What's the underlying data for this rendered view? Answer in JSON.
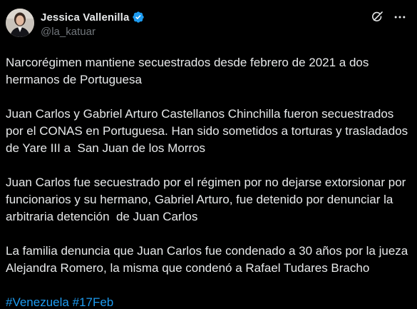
{
  "author": {
    "display_name": "Jessica Vallenilla",
    "handle": "@la_katuar",
    "verified_icon": "verified-badge-icon",
    "verified_color": "#1d9bf0"
  },
  "actions": {
    "grok_icon": "grok-icon",
    "more_icon": "more-options-icon"
  },
  "tweet": {
    "paragraphs": [
      "Narcorégimen mantiene secuestrados desde febrero de 2021 a dos hermanos de Portuguesa",
      "Juan Carlos y Gabriel Arturo Castellanos Chinchilla fueron secuestrados por el CONAS en Portuguesa. Han sido sometidos a torturas y trasladados de Yare III a  San Juan de los Morros",
      "Juan Carlos fue secuestrado por el régimen por no dejarse extorsionar por funcionarios y su hermano, Gabriel Arturo, fue detenido por denunciar la arbitraria detención  de Juan Carlos",
      "La familia denuncia que Juan Carlos fue condenado a 30 años por la jueza Alejandra Romero, la misma que condenó a Rafael Tudares Bracho"
    ],
    "hashtags": [
      "#Venezuela",
      "#17Feb"
    ]
  },
  "colors": {
    "background": "#000000",
    "text": "#e7e9ea",
    "secondary": "#71767b",
    "link": "#1d9bf0"
  }
}
